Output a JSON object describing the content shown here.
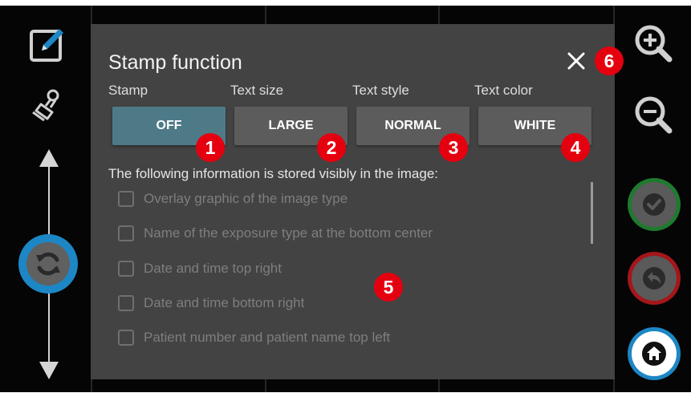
{
  "dialog": {
    "title": "Stamp function",
    "columns": [
      {
        "header": "Stamp",
        "value": "OFF",
        "active": true
      },
      {
        "header": "Text size",
        "value": "LARGE",
        "active": false
      },
      {
        "header": "Text style",
        "value": "NORMAL",
        "active": false
      },
      {
        "header": "Text color",
        "value": "WHITE",
        "active": false
      }
    ],
    "info_text": "The following information is stored visibly in the image:",
    "checkboxes": [
      {
        "label": "Overlay graphic of the image type",
        "checked": false
      },
      {
        "label": "Name of the exposure type at the bottom center",
        "checked": false
      },
      {
        "label": "Date and time top right",
        "checked": false
      },
      {
        "label": "Date and time bottom right",
        "checked": false
      },
      {
        "label": "Patient number and patient name top left",
        "checked": false
      }
    ]
  },
  "badges": [
    "1",
    "2",
    "3",
    "4",
    "5",
    "6"
  ],
  "left_toolbar": {
    "icons": [
      "edit-icon",
      "stamp-icon",
      "arrow-up-icon",
      "rotate-icon",
      "arrow-down-icon"
    ]
  },
  "right_toolbar": {
    "icons": [
      "zoom-in-icon",
      "zoom-out-icon",
      "checkmark-icon",
      "undo-icon",
      "home-icon"
    ],
    "colors": {
      "confirm_ring": "#1f7a2e",
      "undo_ring": "#a4161a",
      "home_ring": "#1d86c4",
      "button_fill": "#5a5a5a"
    }
  },
  "colors": {
    "dialog_bg": "#434343",
    "active_button": "#4e7a88",
    "button": "#5c5c5d",
    "badge": "#e4000f"
  }
}
